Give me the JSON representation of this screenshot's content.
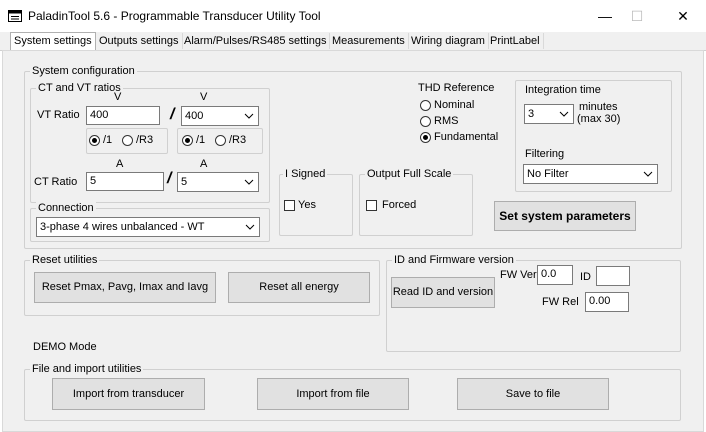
{
  "window": {
    "title": "PaladinTool  5.6 -  Programmable Transducer Utility Tool",
    "minimize": "—",
    "maximize": "☐",
    "close": "✕"
  },
  "tabs": [
    {
      "label": "System settings"
    },
    {
      "label": "Outputs settings"
    },
    {
      "label": "Alarm/Pulses/RS485 settings"
    },
    {
      "label": "Measurements"
    },
    {
      "label": "Wiring diagram"
    },
    {
      "label": "PrintLabel"
    }
  ],
  "system_config": {
    "group_label": "System configuration",
    "ct_vt_label": "CT and VT ratios",
    "v_unit": "V",
    "a_unit": "A",
    "vt_ratio_label": "VT Ratio",
    "vt_primary": "400",
    "vt_secondary": "400",
    "ct_ratio_label": "CT Ratio",
    "ct_primary": "5",
    "ct_secondary": "5",
    "slash": "/",
    "radio_1_label": "/1",
    "radio_r3_label": "/R3",
    "connection_label": "Connection",
    "connection_value": "3-phase 4 wires unbalanced - WT",
    "i_signed_label": "I Signed",
    "yes_label": "Yes",
    "output_full_scale_label": "Output Full Scale",
    "forced_label": "Forced",
    "thd_label": "THD Reference",
    "thd_nominal": "Nominal",
    "thd_rms": "RMS",
    "thd_fundamental": "Fundamental",
    "integration_label": "Integration time",
    "integration_value": "3",
    "minutes_label": "minutes",
    "max_label": "(max 30)",
    "filtering_label": "Filtering",
    "filtering_value": "No Filter",
    "set_button": "Set system parameters"
  },
  "reset": {
    "group_label": "Reset utilities",
    "reset_pmax_button": "Reset Pmax, Pavg, Imax and Iavg",
    "reset_energy_button": "Reset all energy"
  },
  "id_fw": {
    "group_label": "ID and Firmware version",
    "read_button": "Read ID and version",
    "fw_ver_label": "FW Ver",
    "fw_ver_value": "0.0",
    "id_label": "ID",
    "id_value": "",
    "fw_rel_label": "FW Rel",
    "fw_rel_value": "0.00"
  },
  "demo_mode": "DEMO Mode",
  "file_import": {
    "group_label": "File and import utilities",
    "import_transducer_button": "Import from transducer",
    "import_file_button": "Import from file",
    "save_file_button": "Save to file"
  }
}
